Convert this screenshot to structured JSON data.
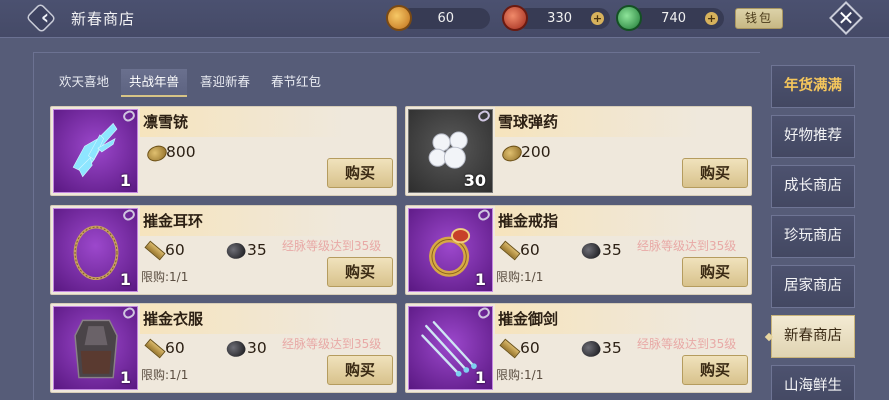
{
  "header": {
    "title": "新春商店",
    "resources": [
      {
        "icon": "firecracker-coin-icon",
        "value": "60",
        "color": "#e0a040"
      },
      {
        "icon": "red-lantern-coin-icon",
        "value": "330",
        "color": "#c8523a"
      },
      {
        "icon": "jade-coin-icon",
        "value": "740",
        "color": "#3fae58"
      }
    ],
    "wallet_label": "钱包"
  },
  "tabs": [
    {
      "label": "欢天喜地",
      "active": false
    },
    {
      "label": "共战年兽",
      "active": true
    },
    {
      "label": "喜迎新春",
      "active": false
    },
    {
      "label": "春节红包",
      "active": false
    }
  ],
  "cards": [
    {
      "name": "凛雪铳",
      "qty": "1",
      "costs": [
        {
          "icon": "copper-coin-icon",
          "value": "800"
        }
      ],
      "requirement": "",
      "limit": "",
      "buy_label": "购买"
    },
    {
      "name": "雪球弹药",
      "qty": "30",
      "costs": [
        {
          "icon": "copper-coin-icon",
          "value": "200"
        }
      ],
      "requirement": "",
      "limit": "",
      "buy_label": "购买"
    },
    {
      "name": "摧金耳环",
      "qty": "1",
      "costs": [
        {
          "icon": "gold-bar-icon",
          "value": "60"
        },
        {
          "icon": "black-ore-icon",
          "value": "35"
        }
      ],
      "requirement": "经脉等级达到35级",
      "limit": "限购:1/1",
      "buy_label": "购买"
    },
    {
      "name": "摧金戒指",
      "qty": "1",
      "costs": [
        {
          "icon": "gold-bar-icon",
          "value": "60"
        },
        {
          "icon": "black-ore-icon",
          "value": "35"
        }
      ],
      "requirement": "经脉等级达到35级",
      "limit": "限购:1/1",
      "buy_label": "购买"
    },
    {
      "name": "摧金衣服",
      "qty": "1",
      "costs": [
        {
          "icon": "gold-bar-icon",
          "value": "60"
        },
        {
          "icon": "black-ore-icon",
          "value": "30"
        }
      ],
      "requirement": "经脉等级达到35级",
      "limit": "限购:1/1",
      "buy_label": "购买"
    },
    {
      "name": "摧金御剑",
      "qty": "1",
      "costs": [
        {
          "icon": "gold-bar-icon",
          "value": "60"
        },
        {
          "icon": "black-ore-icon",
          "value": "35"
        }
      ],
      "requirement": "经脉等级达到35级",
      "limit": "限购:1/1",
      "buy_label": "购买"
    }
  ],
  "sidebar": [
    {
      "label": "年货满满",
      "state": "featured"
    },
    {
      "label": "好物推荐",
      "state": ""
    },
    {
      "label": "成长商店",
      "state": ""
    },
    {
      "label": "珍玩商店",
      "state": ""
    },
    {
      "label": "居家商店",
      "state": ""
    },
    {
      "label": "新春商店",
      "state": "selected"
    },
    {
      "label": "山海鲜生",
      "state": ""
    }
  ]
}
